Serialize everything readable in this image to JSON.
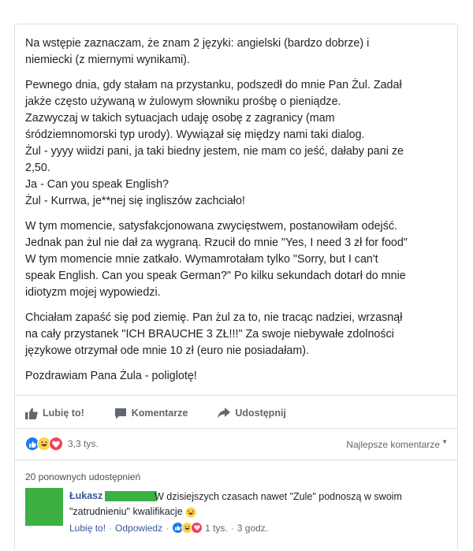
{
  "post": {
    "paragraphs": [
      "Na wstępie zaznaczam, że znam 2 języki: angielski (bardzo dobrze) i\nniemiecki (z miernymi wynikami).",
      "Pewnego dnia, gdy stałam na przystanku, podszedł do mnie Pan Żul. Zadał\njakże często używaną w żulowym słowniku prośbę o pieniądze.\nZazwyczaj w takich sytuacjach udaję osobę z zagranicy (mam\nśródziemnomorski typ urody). Wywiązał się między nami taki dialog.\nŻul - yyyy wiidzi pani, ja taki biedny jestem, nie mam co jeść, dałaby pani ze\n2,50.\nJa - Can you speak English?\nŻul - Kurrwa, je**nej się ingliszów zachciało!",
      "W tym momencie, satysfakcjonowana zwycięstwem, postanowiłam odejść.\nJednak pan żul nie dał za wygraną. Rzucił do mnie \"Yes, I need 3 zł for food\"\nW tym momencie mnie zatkało. Wymamrotałam tylko \"Sorry, but I can't\nspeak English. Can you speak German?\" Po kilku sekundach dotarł do mnie\nidiotyzm mojej wypowiedzi.",
      "Chciałam zapaść się pod ziemię. Pan żul za to, nie tracąc nadziei, wrzasnął\nna cały przystanek \"ICH BRAUCHE 3 ZŁ!!!\" Za swoje niebywałe zdolności\njęzykowe otrzymał ode mnie 10 zł (euro nie posiadałam).",
      "Pozdrawiam Pana Żula - poliglotę!"
    ]
  },
  "actions": {
    "like": "Lubię to!",
    "comment": "Komentarze",
    "share": "Udostępnij"
  },
  "reactions": {
    "count": "3,3 tys.",
    "sort": "Najlepsze komentarze",
    "icons": [
      "like-reaction-icon",
      "haha-reaction-icon",
      "love-reaction-icon"
    ]
  },
  "shares": "20 ponownych udostępnień",
  "comment": {
    "author": "Łukasz",
    "text_line1": "W dzisiejszych czasach nawet \"Zule\" podnoszą w swoim",
    "text_line2": "\"zatrudnieniu\" kwalifikacje",
    "like": "Lubię to!",
    "reply": "Odpowiedz",
    "reaction_count": "1 tys.",
    "time": "3 godz."
  },
  "colors": {
    "link": "#385898",
    "like_blue": "#1877f2",
    "love_red": "#f33e58",
    "haha_yellow": "#fcd34d",
    "redacted_green": "#3cb043"
  }
}
